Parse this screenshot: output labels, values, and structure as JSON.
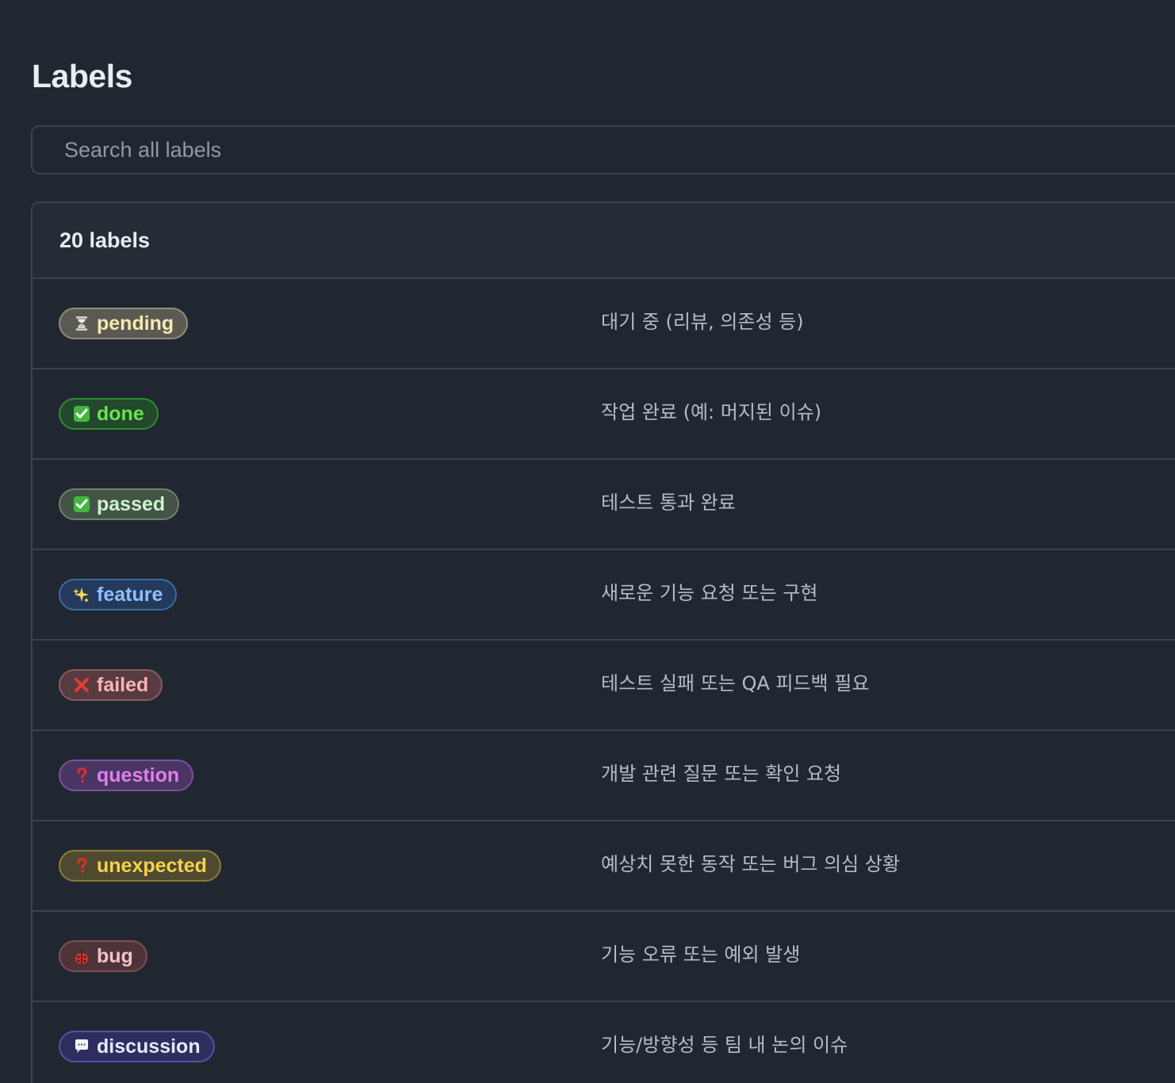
{
  "page": {
    "title": "Labels"
  },
  "search": {
    "placeholder": "Search all labels"
  },
  "labels_panel": {
    "count_text": "20 labels",
    "rows": [
      {
        "name": "pending",
        "icon": "hourglass-icon",
        "description": "대기 중 (리뷰, 의존성 등)",
        "colors": {
          "fg": "#f4eaad",
          "bg": "#5a5a53",
          "border": "#8f8e7d"
        }
      },
      {
        "name": "done",
        "icon": "check-box-icon",
        "description": "작업 완료 (예: 머지된 이슈)",
        "colors": {
          "fg": "#6ee24f",
          "bg": "#22492b",
          "border": "#2f8b2f"
        }
      },
      {
        "name": "passed",
        "icon": "check-box-icon",
        "description": "테스트 통과 완료",
        "colors": {
          "fg": "#cdf2cf",
          "bg": "#435447",
          "border": "#6c8170"
        }
      },
      {
        "name": "feature",
        "icon": "sparkles-icon",
        "description": "새로운 기능 요청 또는 구현",
        "colors": {
          "fg": "#8ec0ff",
          "bg": "#243a5c",
          "border": "#3f6aa3"
        }
      },
      {
        "name": "failed",
        "icon": "cross-mark-icon",
        "description": "테스트 실패 또는 QA 피드백 필요",
        "colors": {
          "fg": "#f8b4b4",
          "bg": "#583b40",
          "border": "#8b5a5e"
        }
      },
      {
        "name": "question",
        "icon": "question-mark-icon",
        "description": "개발 관련 질문 또는 확인 요청",
        "colors": {
          "fg": "#e07ff0",
          "bg": "#4a3563",
          "border": "#7c519e"
        }
      },
      {
        "name": "unexpected",
        "icon": "question-mark-icon",
        "description": "예상치 못한 동작 또는 버그 의심 상황",
        "colors": {
          "fg": "#f5d24e",
          "bg": "#4f4a2f",
          "border": "#8b7d37"
        }
      },
      {
        "name": "bug",
        "icon": "ladybug-icon",
        "description": "기능 오류 또는 예외 발생",
        "colors": {
          "fg": "#f4c1c7",
          "bg": "#4e3439",
          "border": "#7d4e56"
        }
      },
      {
        "name": "discussion",
        "icon": "speech-bubble-icon",
        "description": "기능/방향성 등 팀 내 논의 이슈",
        "colors": {
          "fg": "#e4e7ff",
          "bg": "#2d2e5e",
          "border": "#5153a4"
        }
      }
    ]
  }
}
